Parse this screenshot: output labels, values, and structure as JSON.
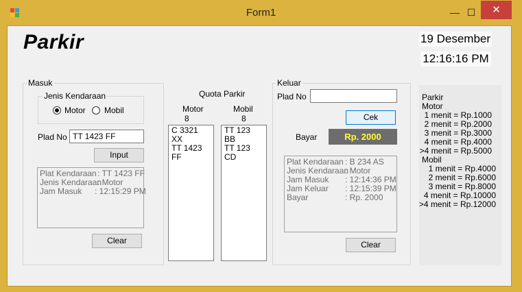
{
  "window": {
    "title": "Form1",
    "minimize_glyph": "—",
    "maximize_glyph": "☐",
    "close_glyph": "✕"
  },
  "app_title": "Parkir",
  "date": "19 Desember",
  "time": "12:16:16 PM",
  "masuk": {
    "group_title": "Masuk",
    "jenis_title": "Jenis Kendaraan",
    "radio_motor": "Motor",
    "radio_mobil": "Mobil",
    "selected": "Motor",
    "plad_label": "Plad No",
    "plad_value": "TT 1423 FF",
    "input_button": "Input",
    "summary": [
      {
        "label": "Plat Kendaraan",
        "value": ": TT 1423 FF"
      },
      {
        "label": "Jenis Kendaraan",
        "value": ": Motor"
      },
      {
        "label": "Jam Masuk",
        "value": ": 12:15:29 PM"
      }
    ],
    "clear_button": "Clear"
  },
  "quota": {
    "title": "Quota Parkir",
    "motor_label": "Motor",
    "motor_count": "8",
    "mobil_label": "Mobil",
    "mobil_count": "8",
    "motor_list": [
      "C 3321 XX",
      "TT 1423 FF"
    ],
    "mobil_list": [
      "TT 123 BB",
      "TT 123 CD"
    ]
  },
  "keluar": {
    "group_title": "Keluar",
    "plad_label": "Plad No",
    "plad_value": "",
    "cek_button": "Cek",
    "bayar_label": "Bayar",
    "bayar_value": "Rp. 2000",
    "summary": [
      {
        "label": "Plat Kendaraan",
        "value": ": B 234 AS"
      },
      {
        "label": "Jenis Kendaraan",
        "value": ": Motor"
      },
      {
        "label": "Jam Masuk",
        "value": ": 12:14:36 PM"
      },
      {
        "label": "Jam Keluar",
        "value": ": 12:15:39 PM"
      },
      {
        "label": "Bayar",
        "value": ": Rp. 2000"
      }
    ],
    "clear_button": "Clear"
  },
  "tarif": {
    "title": "Parkir",
    "motor_title": "Motor",
    "motor": [
      "1 menit = Rp.1000",
      "2 menit = Rp.2000",
      "3 menit = Rp.3000",
      "4 menit = Rp.4000",
      ">4 menit = Rp.5000"
    ],
    "mobil_title": "Mobil",
    "mobil": [
      "1 menit = Rp.4000",
      "2 menit = Rp.6000",
      "3 menit = Rp.8000",
      "4 menit = Rp.10000",
      ">4 menit = Rp.12000"
    ]
  },
  "colors": {
    "titlebar": "#dcb33e",
    "close": "#c7403a",
    "bayar_bg": "#6d6d6d",
    "bayar_text": "#ffff33"
  }
}
